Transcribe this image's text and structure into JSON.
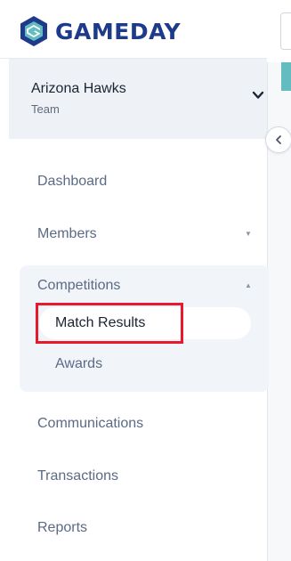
{
  "brand": {
    "name": "GAMEDAY",
    "logo_icon": "gameday-logo-icon"
  },
  "team": {
    "name": "Arizona Hawks",
    "type": "Team"
  },
  "nav": {
    "dashboard": "Dashboard",
    "members": "Members",
    "competitions": "Competitions",
    "match_results": "Match Results",
    "awards": "Awards",
    "communications": "Communications",
    "transactions": "Transactions",
    "reports": "Reports"
  },
  "colors": {
    "brand_dark": "#1e3a8a",
    "accent_teal": "#63bcc0",
    "highlight_red": "#e8192c",
    "nav_text": "#5b6a85"
  }
}
